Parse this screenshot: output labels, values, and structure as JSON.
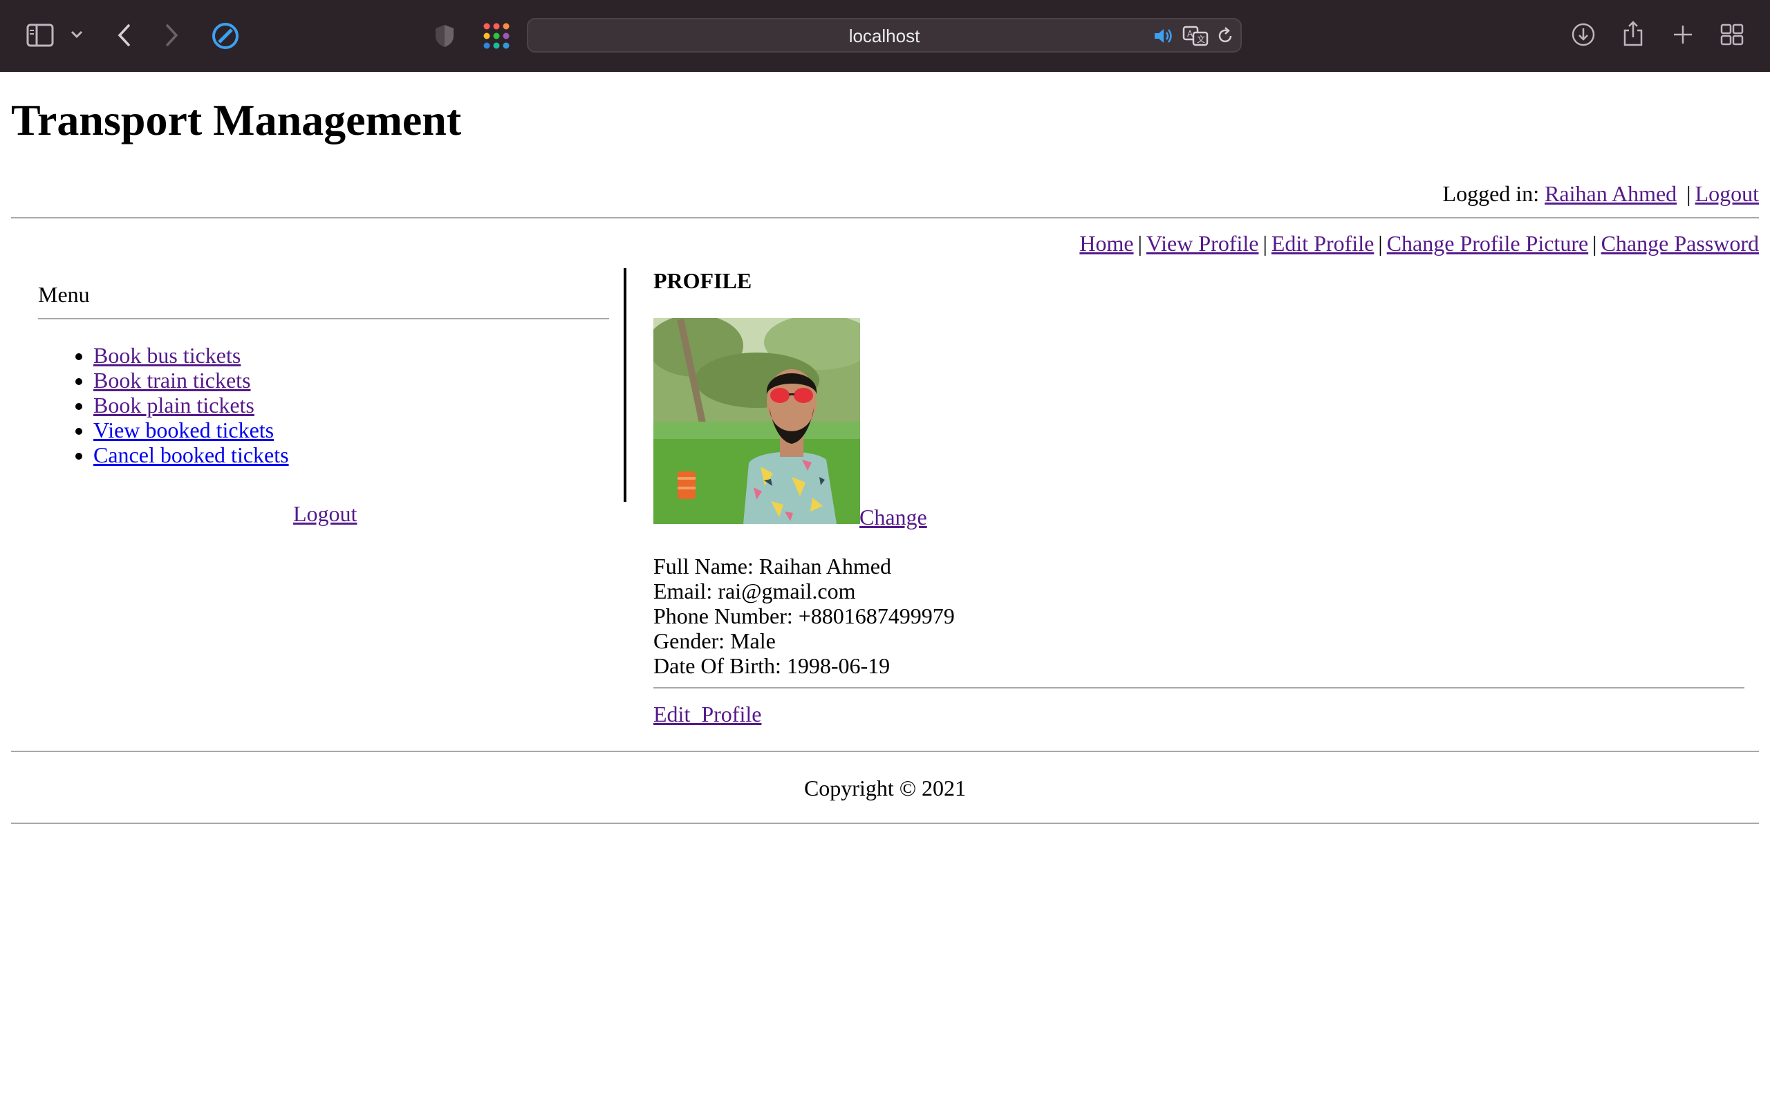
{
  "browser": {
    "url": "localhost",
    "icons": [
      "sidebar-icon",
      "chevron-down-icon",
      "back-icon",
      "forward-icon",
      "safari-compass-icon",
      "shield-icon",
      "apps-grid-icon",
      "speaker-icon",
      "translate-icon",
      "reload-icon",
      "download-icon",
      "share-icon",
      "new-tab-icon",
      "tab-overview-icon"
    ]
  },
  "header": {
    "title": "Transport Management",
    "logged_in_label": "Logged in:",
    "user_name": "Raihan Ahmed",
    "logout_label": "Logout"
  },
  "nav": {
    "items": [
      "Home",
      "View Profile",
      "Edit Profile",
      "Change Profile Picture",
      "Change Password"
    ]
  },
  "sidebar": {
    "title": "Menu",
    "items": [
      "Book bus tickets",
      "Book train tickets",
      "Book plain tickets",
      "View booked tickets",
      "Cancel booked tickets"
    ],
    "logout_label": "Logout"
  },
  "profile": {
    "heading": "PROFILE",
    "change_label": "Change",
    "full_name": "Full Name: Raihan Ahmed",
    "email": "Email: rai@gmail.com",
    "phone": "Phone Number: +8801687499979",
    "gender": "Gender: Male",
    "dob": "Date Of Birth: 1998-06-19",
    "edit_label": "Edit_Profile"
  },
  "footer": {
    "copyright": "Copyright © 2021"
  }
}
